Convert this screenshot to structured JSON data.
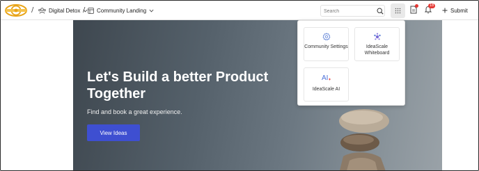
{
  "header": {
    "breadcrumb_sep": "/",
    "workspace_label": "Digital Detox",
    "community_label": "Community Landing",
    "search_placeholder": "Search",
    "notification_count": "18",
    "submit_label": "Submit"
  },
  "apps_menu": {
    "items": [
      {
        "label": "Community Settings",
        "icon": "gear-icon"
      },
      {
        "label": "IdeaScale Whiteboard",
        "icon": "whiteboard-icon"
      },
      {
        "label": "IdeaScale AI",
        "icon": "ai-icon"
      }
    ]
  },
  "hero": {
    "title": "Let's Build a better Product Together",
    "subtitle": "Find and book a great experience.",
    "cta_label": "View Ideas"
  },
  "colors": {
    "primary": "#3e4fd1",
    "badge": "#e53935",
    "logo": "#e8a317"
  }
}
